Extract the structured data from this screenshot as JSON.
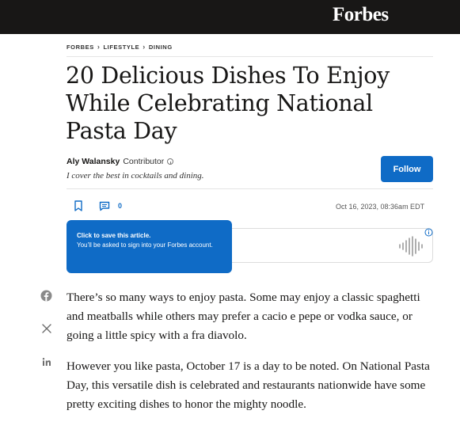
{
  "header": {
    "logo": "Forbes"
  },
  "breadcrumb": [
    "FORBES",
    "LIFESTYLE",
    "DINING"
  ],
  "article": {
    "headline_lines": [
      "20 Delicious Dishes To Enjoy",
      "While Celebrating National",
      "Pasta Day"
    ],
    "author_name": "Aly Walansky",
    "author_role": "Contributor",
    "author_bio": "I cover the best in cocktails and dining.",
    "follow_label": "Follow",
    "comment_count": "0",
    "date": "Oct 16, 2023, 08:36am EDT",
    "paragraphs": [
      "There’s so many ways to enjoy pasta. Some may enjoy a classic spaghetti and meatballs while others may prefer a cacio e pepe or vodka sauce, or going a little spicy with a fra diavolo.",
      "However you like pasta, October 17 is a day to be noted. On National Pasta Day, this versatile dish is celebrated and restaurants nationwide have some pretty exciting dishes to honor the mighty noodle."
    ]
  },
  "tooltip": {
    "title": "Click to save this article.",
    "body": "You’ll be asked to sign into your Forbes account."
  },
  "icons": {
    "bookmark": "bookmark-icon",
    "comment": "comment-icon",
    "info": "info-icon",
    "audio": "audio-waveform-icon",
    "facebook": "facebook-icon",
    "x": "x-icon",
    "linkedin": "linkedin-icon"
  },
  "colors": {
    "accent": "#0f6bc6",
    "topbar": "#181716"
  }
}
